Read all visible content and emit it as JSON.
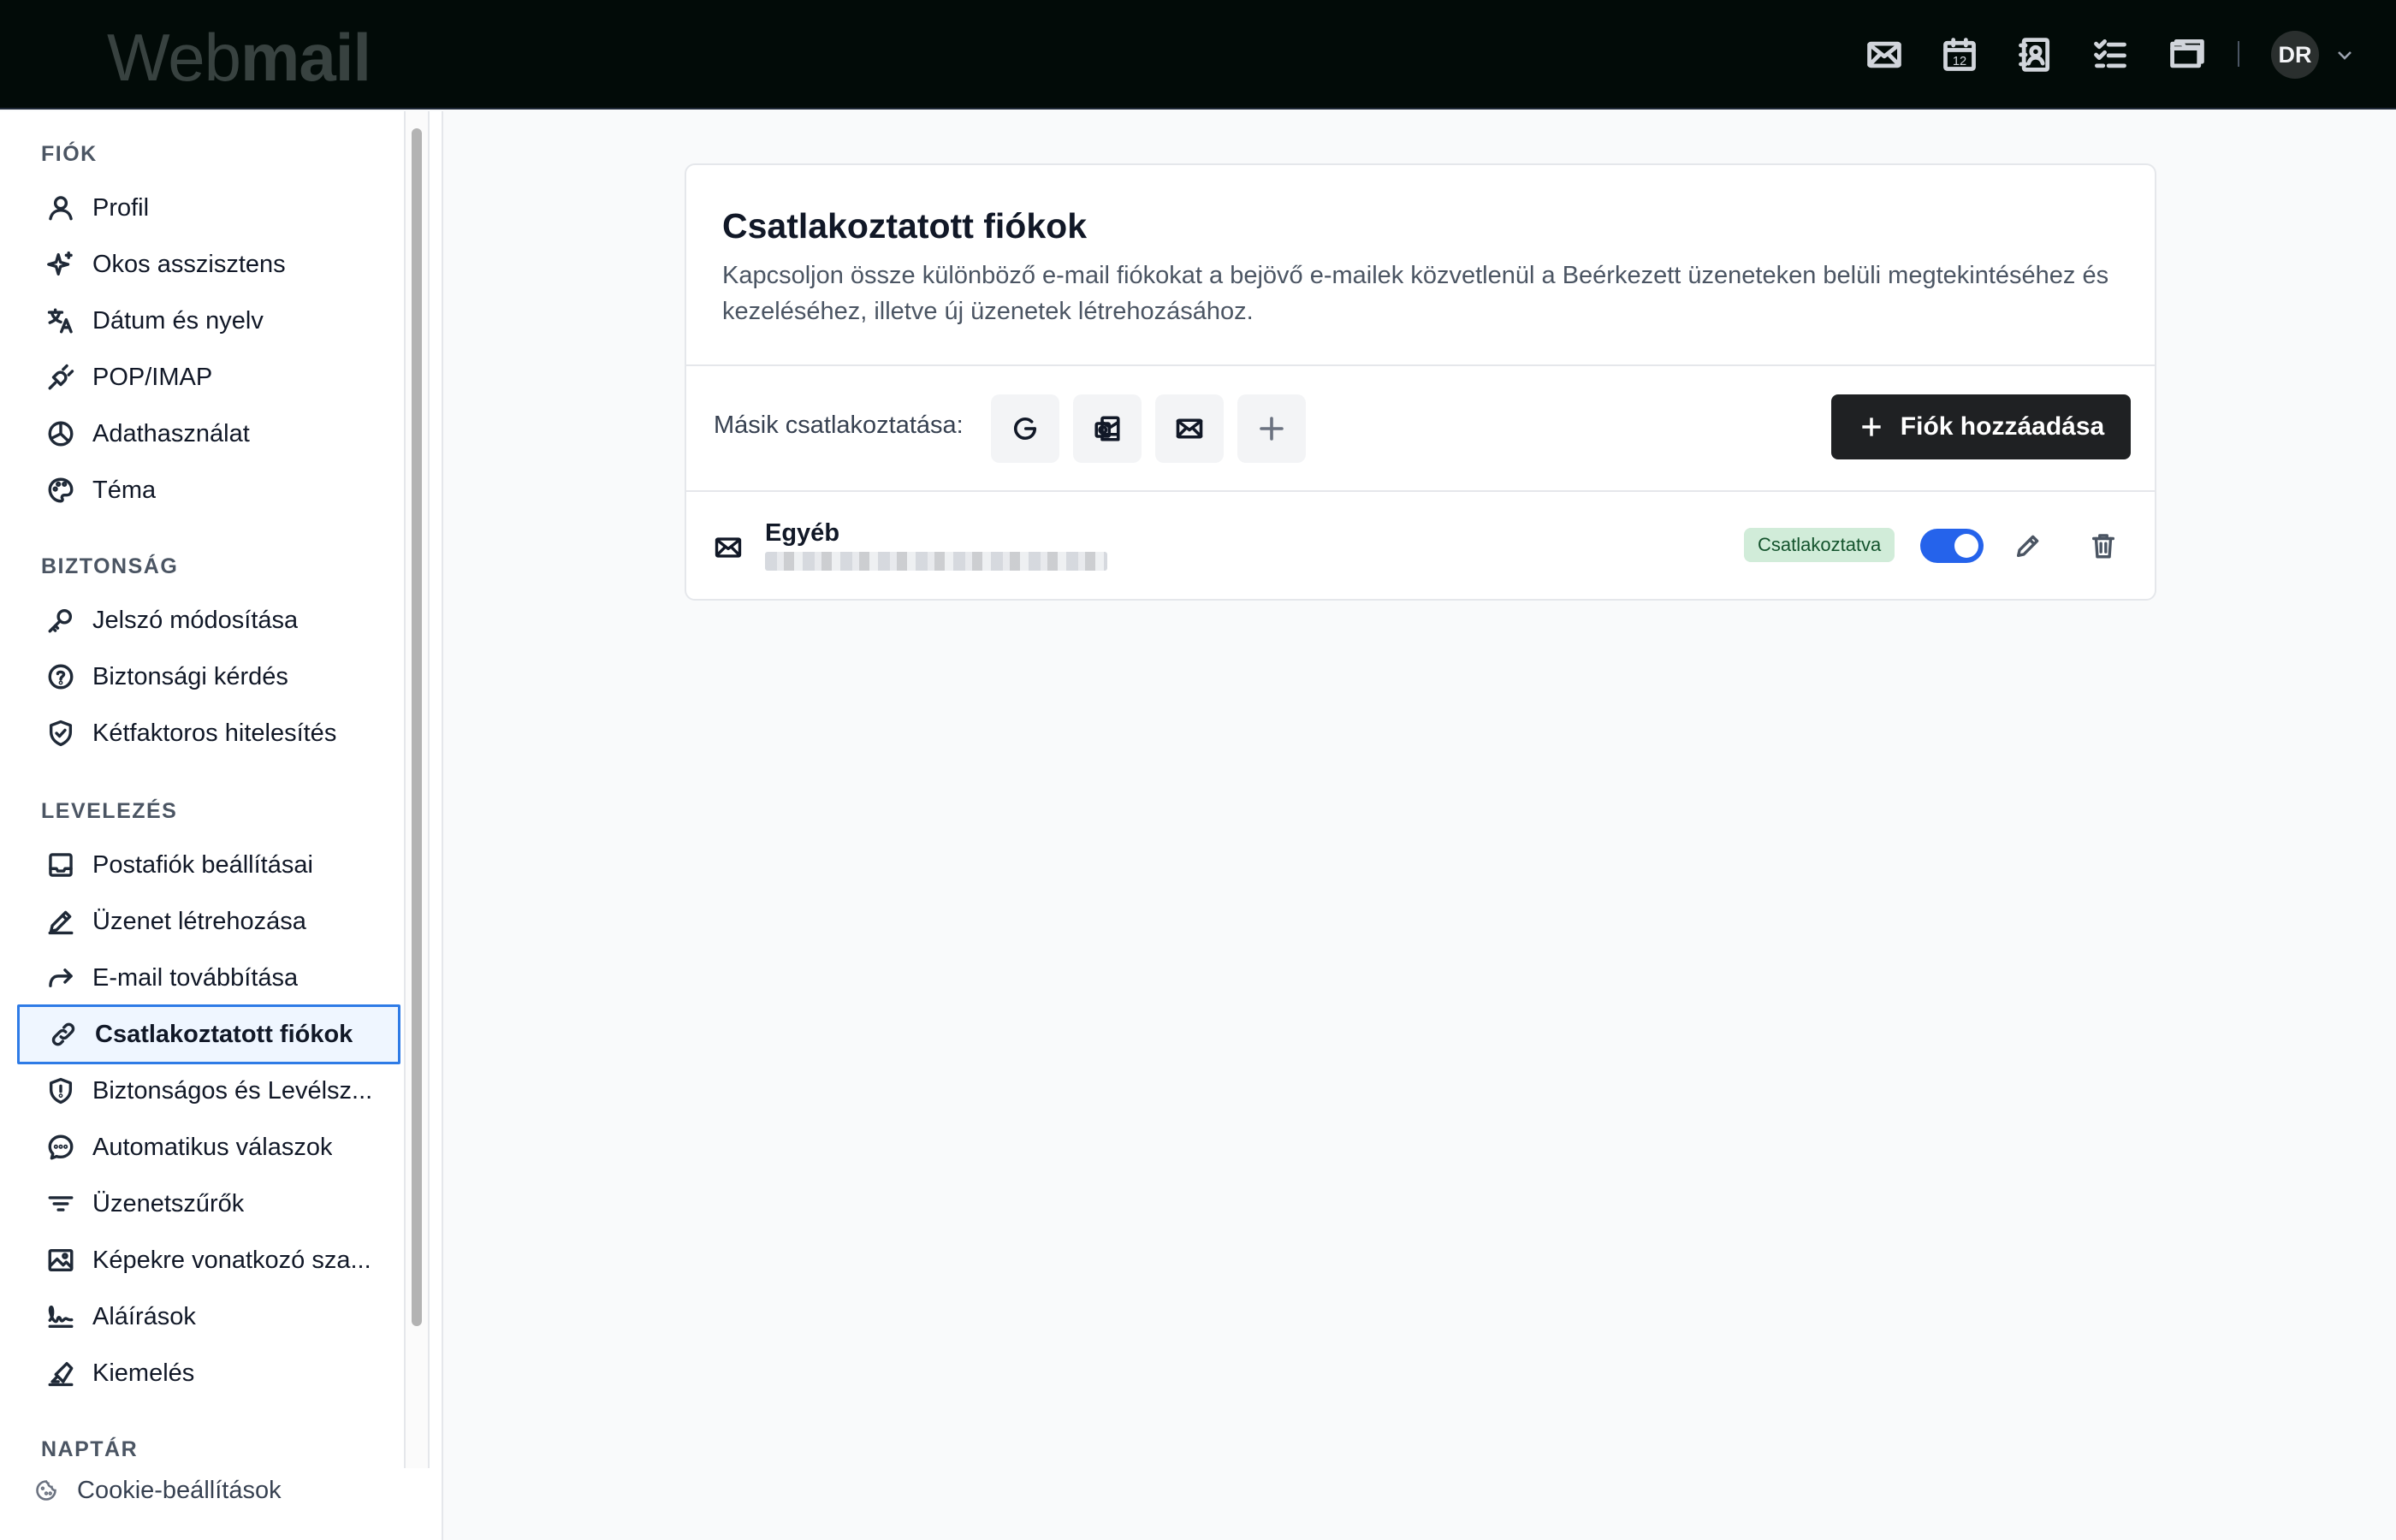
{
  "app": {
    "logo_part1": "Web",
    "logo_part2": "mail",
    "user_initials": "DR"
  },
  "topbar": {
    "icons": [
      "mail-icon",
      "calendar-icon",
      "contacts-icon",
      "tasks-icon",
      "folder-icon"
    ],
    "calendar_day": "12"
  },
  "sidebar": {
    "sections": [
      {
        "title": "FIÓK",
        "items": [
          {
            "label": "Profil",
            "icon": "user-icon"
          },
          {
            "label": "Okos asszisztens",
            "icon": "sparkles-icon"
          },
          {
            "label": "Dátum és nyelv",
            "icon": "language-icon"
          },
          {
            "label": "POP/IMAP",
            "icon": "plug-icon"
          },
          {
            "label": "Adathasználat",
            "icon": "pie-chart-icon"
          },
          {
            "label": "Téma",
            "icon": "palette-icon"
          }
        ]
      },
      {
        "title": "BIZTONSÁG",
        "items": [
          {
            "label": "Jelszó módosítása",
            "icon": "key-icon"
          },
          {
            "label": "Biztonsági kérdés",
            "icon": "question-circle-icon"
          },
          {
            "label": "Kétfaktoros hitelesítés",
            "icon": "shield-check-icon"
          }
        ]
      },
      {
        "title": "LEVELEZÉS",
        "items": [
          {
            "label": "Postafiók beállításai",
            "icon": "inbox-icon"
          },
          {
            "label": "Üzenet létrehozása",
            "icon": "pencil-icon"
          },
          {
            "label": "E-mail továbbítása",
            "icon": "forward-icon"
          },
          {
            "label": "Csatlakoztatott fiókok",
            "icon": "link-icon",
            "active": true
          },
          {
            "label": "Biztonságos és Levélsz...",
            "icon": "shield-alert-icon"
          },
          {
            "label": "Automatikus válaszok",
            "icon": "chat-icon"
          },
          {
            "label": "Üzenetszűrők",
            "icon": "filter-icon"
          },
          {
            "label": "Képekre vonatkozó sza...",
            "icon": "image-icon"
          },
          {
            "label": "Aláírások",
            "icon": "signature-icon"
          },
          {
            "label": "Kiemelés",
            "icon": "highlighter-icon"
          }
        ]
      },
      {
        "title": "NAPTÁR",
        "items": []
      }
    ],
    "cookie_label": "Cookie-beállítások"
  },
  "main": {
    "title": "Csatlakoztatott fiókok",
    "description": "Kapcsoljon össze különböző e-mail fiókokat a bejövő e-mailek közvetlenül a Beérkezett üzeneteken belüli megtekintéséhez és kezeléséhez, illetve új üzenetek létrehozásához.",
    "connect_other_label": "Másik csatlakoztatása:",
    "providers": [
      "google-icon",
      "outlook-icon",
      "mail-icon",
      "plus-icon"
    ],
    "add_account_label": "Fiók hozzáadása",
    "accounts": [
      {
        "name": "Egyéb",
        "status": "Csatlakoztatva",
        "enabled": true
      }
    ]
  },
  "colors": {
    "accent": "#2563eb",
    "topbar": "#020b08",
    "badge_bg": "#d1ecd9"
  }
}
